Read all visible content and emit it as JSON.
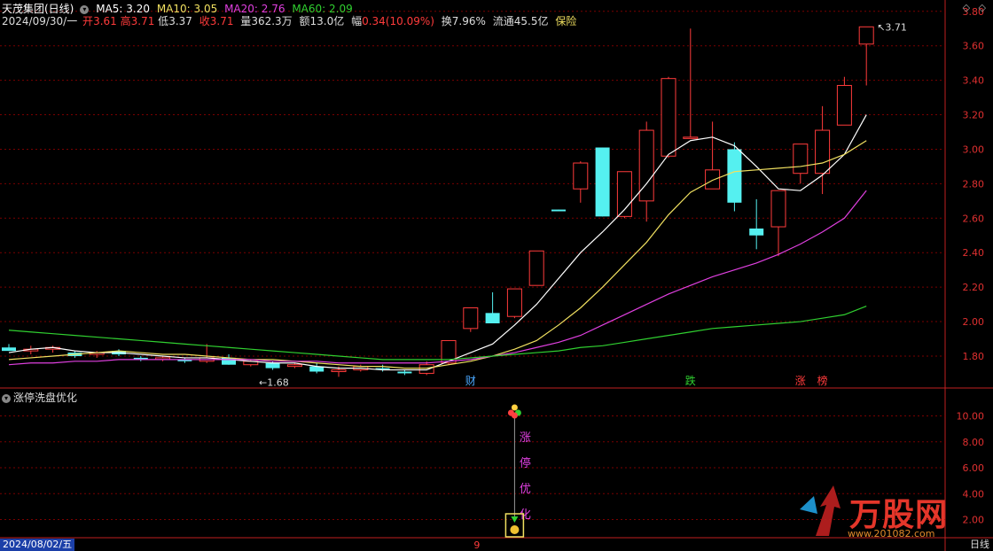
{
  "header": {
    "stock_name": "天茂集团(日线)",
    "ma5": "MA5: 3.20",
    "ma10": "MA10: 3.05",
    "ma20": "MA20: 2.76",
    "ma60": "MA60: 2.09",
    "date": "2024/09/30/一",
    "open_label": "开",
    "open": "3.61",
    "high_label": "高",
    "high": "3.71",
    "low_label": "低",
    "low": "3.37",
    "close_label": "收",
    "close": "3.71",
    "volume_label": "量",
    "volume": "362.3万",
    "amount_label": "额",
    "amount": "13.0亿",
    "change_label": "幅",
    "change": "0.34(10.09%)",
    "turnover_label": "换",
    "turnover": "7.96%",
    "float_label": "流通",
    "float": "45.5亿",
    "sector": "保险"
  },
  "colors": {
    "up": "#ff3b3b",
    "down": "#55f0f0",
    "ma5": "#ffffff",
    "ma10": "#f0e060",
    "ma20": "#e040e0",
    "ma60": "#30d030",
    "grid": "#7a0000",
    "axis": "#c02020"
  },
  "price_axis": [
    "3.80",
    "3.60",
    "3.40",
    "3.20",
    "3.00",
    "2.80",
    "2.60",
    "2.40",
    "2.20",
    "2.00",
    "1.80"
  ],
  "sub_axis": [
    "10.00",
    "8.00",
    "6.00",
    "4.00",
    "2.00"
  ],
  "chart_data": {
    "type": "candlestick",
    "ylim": [
      1.62,
      3.84
    ],
    "candles": [
      {
        "o": 1.85,
        "h": 1.87,
        "l": 1.83,
        "c": 1.83
      },
      {
        "o": 1.83,
        "h": 1.86,
        "l": 1.81,
        "c": 1.84
      },
      {
        "o": 1.84,
        "h": 1.86,
        "l": 1.82,
        "c": 1.85
      },
      {
        "o": 1.82,
        "h": 1.83,
        "l": 1.79,
        "c": 1.8
      },
      {
        "o": 1.81,
        "h": 1.83,
        "l": 1.79,
        "c": 1.82
      },
      {
        "o": 1.83,
        "h": 1.84,
        "l": 1.8,
        "c": 1.81
      },
      {
        "o": 1.79,
        "h": 1.8,
        "l": 1.77,
        "c": 1.78
      },
      {
        "o": 1.78,
        "h": 1.8,
        "l": 1.77,
        "c": 1.79
      },
      {
        "o": 1.78,
        "h": 1.79,
        "l": 1.76,
        "c": 1.77
      },
      {
        "o": 1.77,
        "h": 1.87,
        "l": 1.76,
        "c": 1.79
      },
      {
        "o": 1.79,
        "h": 1.81,
        "l": 1.75,
        "c": 1.75
      },
      {
        "o": 1.75,
        "h": 1.78,
        "l": 1.74,
        "c": 1.77
      },
      {
        "o": 1.76,
        "h": 1.77,
        "l": 1.72,
        "c": 1.73
      },
      {
        "o": 1.74,
        "h": 1.76,
        "l": 1.73,
        "c": 1.75
      },
      {
        "o": 1.74,
        "h": 1.76,
        "l": 1.7,
        "c": 1.71
      },
      {
        "o": 1.71,
        "h": 1.74,
        "l": 1.68,
        "c": 1.72
      },
      {
        "o": 1.72,
        "h": 1.75,
        "l": 1.71,
        "c": 1.74
      },
      {
        "o": 1.73,
        "h": 1.75,
        "l": 1.71,
        "c": 1.72
      },
      {
        "o": 1.71,
        "h": 1.72,
        "l": 1.69,
        "c": 1.7
      },
      {
        "o": 1.7,
        "h": 1.77,
        "l": 1.69,
        "c": 1.75
      },
      {
        "o": 1.76,
        "h": 1.89,
        "l": 1.75,
        "c": 1.89
      },
      {
        "o": 1.96,
        "h": 2.08,
        "l": 1.94,
        "c": 2.08
      },
      {
        "o": 2.05,
        "h": 2.17,
        "l": 1.99,
        "c": 1.99
      },
      {
        "o": 2.03,
        "h": 2.19,
        "l": 2.02,
        "c": 2.19
      },
      {
        "o": 2.21,
        "h": 2.41,
        "l": 2.21,
        "c": 2.41
      },
      {
        "o": 2.65,
        "h": 2.65,
        "l": 2.64,
        "c": 2.64
      },
      {
        "o": 2.77,
        "h": 2.93,
        "l": 2.69,
        "c": 2.92
      },
      {
        "o": 3.01,
        "h": 3.01,
        "l": 2.61,
        "c": 2.61
      },
      {
        "o": 2.61,
        "h": 2.87,
        "l": 2.6,
        "c": 2.87
      },
      {
        "o": 2.7,
        "h": 3.16,
        "l": 2.58,
        "c": 3.11
      },
      {
        "o": 2.96,
        "h": 3.42,
        "l": 2.95,
        "c": 3.41
      },
      {
        "o": 3.07,
        "h": 3.7,
        "l": 3.07,
        "c": 3.07
      },
      {
        "o": 2.77,
        "h": 3.16,
        "l": 2.77,
        "c": 2.88
      },
      {
        "o": 3.0,
        "h": 3.04,
        "l": 2.64,
        "c": 2.69
      },
      {
        "o": 2.54,
        "h": 2.71,
        "l": 2.42,
        "c": 2.5
      },
      {
        "o": 2.55,
        "h": 2.75,
        "l": 2.38,
        "c": 2.76
      },
      {
        "o": 2.86,
        "h": 3.03,
        "l": 2.8,
        "c": 3.03
      },
      {
        "o": 2.86,
        "h": 3.25,
        "l": 2.74,
        "c": 3.11
      },
      {
        "o": 3.14,
        "h": 3.42,
        "l": 3.14,
        "c": 3.37
      },
      {
        "o": 3.61,
        "h": 3.71,
        "l": 3.37,
        "c": 3.71
      }
    ],
    "ma5": [
      1.82,
      1.84,
      1.85,
      1.83,
      1.82,
      1.82,
      1.81,
      1.8,
      1.79,
      1.79,
      1.78,
      1.77,
      1.76,
      1.76,
      1.74,
      1.73,
      1.73,
      1.72,
      1.72,
      1.72,
      1.77,
      1.82,
      1.87,
      1.98,
      2.1,
      2.25,
      2.4,
      2.52,
      2.65,
      2.8,
      2.97,
      3.05,
      3.07,
      3.02,
      2.9,
      2.77,
      2.76,
      2.85,
      2.97,
      3.2
    ],
    "ma10": [
      1.78,
      1.79,
      1.8,
      1.81,
      1.82,
      1.83,
      1.82,
      1.81,
      1.81,
      1.8,
      1.79,
      1.78,
      1.78,
      1.77,
      1.76,
      1.75,
      1.74,
      1.74,
      1.73,
      1.73,
      1.75,
      1.77,
      1.8,
      1.84,
      1.89,
      1.98,
      2.08,
      2.2,
      2.33,
      2.46,
      2.62,
      2.75,
      2.82,
      2.87,
      2.88,
      2.89,
      2.9,
      2.92,
      2.97,
      3.05
    ],
    "ma20": [
      1.75,
      1.76,
      1.76,
      1.77,
      1.77,
      1.78,
      1.78,
      1.78,
      1.78,
      1.78,
      1.78,
      1.78,
      1.77,
      1.77,
      1.77,
      1.76,
      1.76,
      1.76,
      1.76,
      1.76,
      1.77,
      1.78,
      1.8,
      1.82,
      1.85,
      1.88,
      1.92,
      1.98,
      2.04,
      2.1,
      2.16,
      2.21,
      2.26,
      2.3,
      2.34,
      2.39,
      2.45,
      2.52,
      2.6,
      2.76
    ],
    "ma60": [
      1.95,
      1.94,
      1.93,
      1.92,
      1.91,
      1.9,
      1.89,
      1.88,
      1.87,
      1.86,
      1.85,
      1.84,
      1.83,
      1.82,
      1.81,
      1.8,
      1.79,
      1.78,
      1.78,
      1.78,
      1.78,
      1.79,
      1.8,
      1.81,
      1.82,
      1.83,
      1.85,
      1.86,
      1.88,
      1.9,
      1.92,
      1.94,
      1.96,
      1.97,
      1.98,
      1.99,
      2.0,
      2.02,
      2.04,
      2.09
    ],
    "low_marker": "1.68",
    "high_marker": "3.71",
    "events": [
      {
        "index": 21,
        "label": "财",
        "color": "#4aa8ff"
      },
      {
        "index": 31,
        "label": "跌",
        "color": "#30d030"
      },
      {
        "index": 36,
        "label": "涨",
        "color": "#ff3b3b"
      },
      {
        "index": 37,
        "label": "榜",
        "color": "#ff3b3b"
      }
    ],
    "signal": {
      "index": 23,
      "text": [
        "涨",
        "停",
        "优",
        "化"
      ],
      "color": "#e040e0"
    },
    "time_label": "9"
  },
  "subchart": {
    "title": "涨停洗盘优化"
  },
  "footer": {
    "date": "2024/08/02/五",
    "line_type": "日线"
  },
  "watermark": {
    "brand": "万股网",
    "url": "www.201082.com"
  }
}
